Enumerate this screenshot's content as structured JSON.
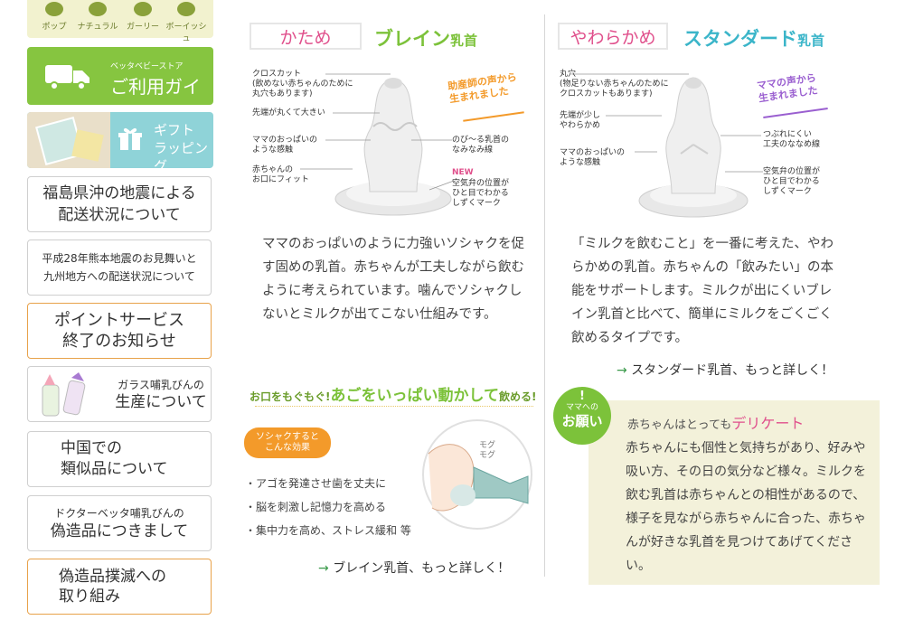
{
  "sidebar": {
    "styles": [
      "ポップ",
      "ナチュラル",
      "ガーリー",
      "ボーイッシュ"
    ],
    "guide": {
      "small": "ベッタベビーストア",
      "label": "ご利用ガイド"
    },
    "gift": {
      "line1": "ギフト",
      "line2": "ラッピング"
    },
    "items": [
      {
        "text1": "福島県沖の地震による",
        "text2": "配送状況について"
      },
      {
        "text1": "平成28年熊本地震のお見舞いと",
        "text2": "九州地方への配送状況について"
      },
      {
        "text1": "ポイントサービス",
        "text2": "終了のお知らせ"
      },
      {
        "text1": "ガラス哺乳びんの",
        "text2": "生産について"
      },
      {
        "text1": "中国での",
        "text2": "類似品について"
      },
      {
        "text1": "ドクターベッタ哺乳びんの",
        "text2": "偽造品につきまして"
      },
      {
        "text1": "偽造品撲滅への",
        "text2": "取り組み"
      }
    ]
  },
  "left": {
    "tag": "かため",
    "title": "ブレイン",
    "title_suffix": "乳首",
    "labels": {
      "cross": "クロスカット\n(飲めない赤ちゃんのために\n丸穴もあります)",
      "tip": "先端が丸くて大きい",
      "mom": "ママのおっぱいの\nような感触",
      "baby": "赤ちゃんの\nお口にフィット",
      "wave": "のび～る乳首の\nなみなみ線",
      "new": "NEW",
      "valve": "空気弁の位置が\nひと目でわかる\nしずくマーク"
    },
    "note": "助産師の声から\n生まれました",
    "desc": "ママのおっぱいのように力強いソシャクを促す固めの乳首。赤ちゃんが工夫しながら飲むように考えられています。噛んでソシャクしないとミルクが出てこない仕組みです。",
    "headline_pre": "お口をもぐもぐ!",
    "headline_main": "あごをいっぱい動かして",
    "headline_post": "飲める!",
    "badge": "ソシャクすると\nこんな効果",
    "effects": [
      "・アゴを発達させ歯を丈夫に",
      "・脳を刺激し記憶力を高める",
      "・集中力を高め、ストレス緩和 等"
    ],
    "illus_text": "モグ\nモグ",
    "link_arrow": "→",
    "link": "ブレイン乳首、もっと詳しく！"
  },
  "right": {
    "tag": "やわらかめ",
    "title": "スタンダード",
    "title_suffix": "乳首",
    "labels": {
      "hole": "丸穴\n(物足りない赤ちゃんのために\nクロスカットもあります)",
      "tip": "先端が少し\nやわらかめ",
      "mom": "ママのおっぱいの\nような感触",
      "stable": "つぶれにくい\n工夫のななめ線",
      "valve": "空気弁の位置が\nひと目でわかる\nしずくマーク"
    },
    "note": "ママの声から\n生まれました",
    "desc": "「ミルクを飲むこと」を一番に考えた、やわらかめの乳首。赤ちゃんの「飲みたい」の本能をサポートします。ミルクが出にくいブレイン乳首と比べて、簡単にミルクをごくごく飲めるタイプです。",
    "link_arrow": "→",
    "link": "スタンダード乳首、もっと詳しく！",
    "badge_mark": "!",
    "badge_line1": "ママへの",
    "badge_line2": "お願い",
    "tip_title_pre": "赤ちゃんはとっても",
    "tip_title_em": "デリケート",
    "tip_body": "赤ちゃんにも個性と気持ちがあり、好みや吸い方、その日の気分など様々。ミルクを飲む乳首は赤ちゃんとの相性があるので、様子を見ながら赤ちゃんに合った、赤ちゃんが好きな乳首を見つけてあげてください。"
  },
  "colors": {
    "green": "#7cc23a",
    "teal": "#3bb5c9",
    "orange": "#f39a2a",
    "pink": "#e0508c",
    "purple": "#9a5fd0"
  }
}
